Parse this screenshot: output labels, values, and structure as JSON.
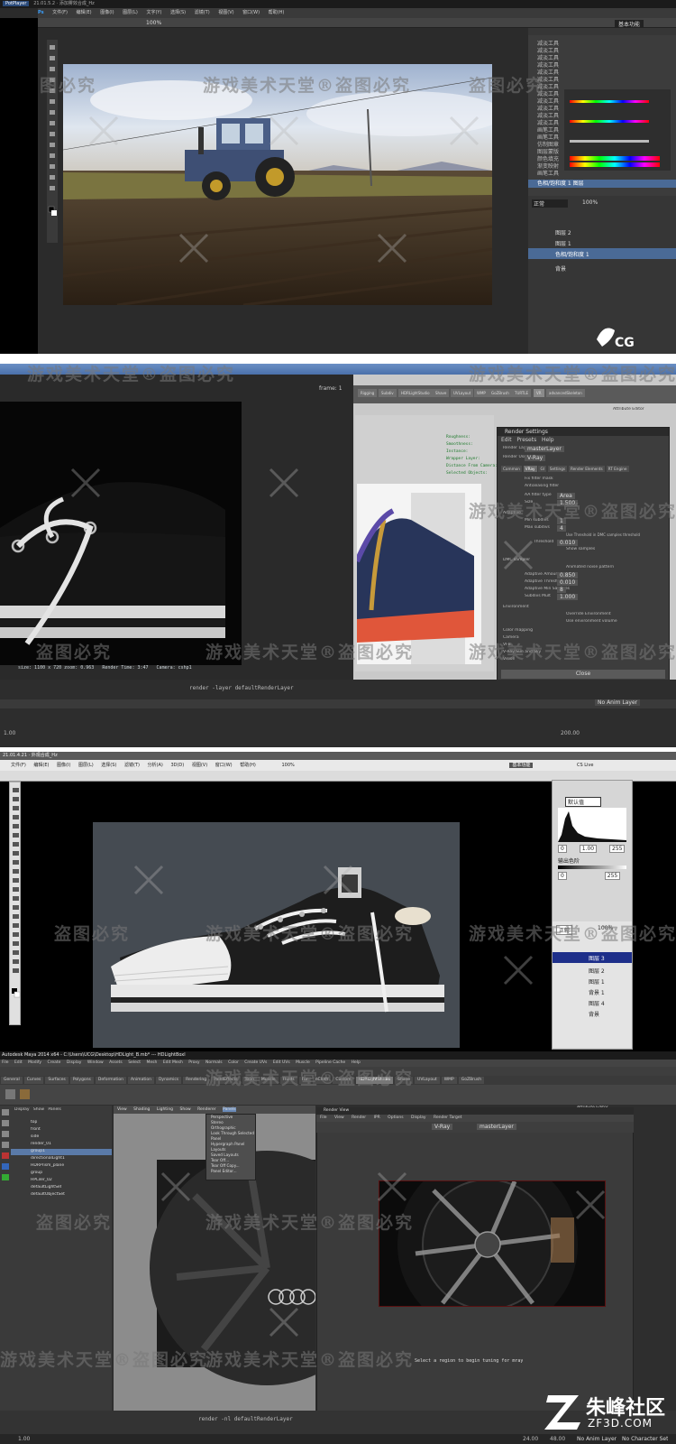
{
  "panel1": {
    "app_tab": "PotPlayer",
    "title": "21.01.5.2 · 添加雾效合成_Hz",
    "app_icon": "Ps",
    "menu": [
      "文件(F)",
      "编辑(E)",
      "图像(I)",
      "图层(L)",
      "文字(Y)",
      "选择(S)",
      "滤镜(T)",
      "视图(V)",
      "窗口(W)",
      "帮助(H)"
    ],
    "zoom": "100%",
    "workspace": "基本功能",
    "layers": [
      "减淡工具",
      "减淡工具",
      "减淡工具",
      "减淡工具",
      "减淡工具",
      "减淡工具",
      "减淡工具",
      "减淡工具",
      "减淡工具",
      "减淡工具",
      "减淡工具",
      "减淡工具",
      "画笔工具",
      "画笔工具",
      "仿制图章",
      "图层蒙版",
      "颜色填充",
      "渐变映射",
      "画笔工具"
    ],
    "active_layer": "色相/饱和度 1 图层",
    "layer_items": [
      "图层 2",
      "图层 1",
      "色相/饱和度 1",
      "背景"
    ],
    "blend_mode": "正常",
    "opacity": "100%",
    "logo": "CG"
  },
  "panel2": {
    "render_size": "size: 1100 x 720  zoom: 0.963",
    "render_time": "Render Time: 3:47",
    "camera": "Camera: cshp1",
    "frame_label": "frame: 1",
    "attr_lines": [
      "Roughness:",
      "Smoothness:",
      "Instance:",
      "Wrapper Layer:",
      "Distance From Camera:",
      "Selected Objects:"
    ],
    "shelf_tabs": [
      "Rigging",
      "Subdiv",
      "HDRLightStudio",
      "Shave",
      "UVLayout",
      "WMP",
      "GoZBrush",
      "TURTLE",
      "VR",
      "advancedSkeleton"
    ],
    "window_title": "Render Settings",
    "menu": [
      "Edit",
      "Presets",
      "Help"
    ],
    "render_layer_label": "Render Layer",
    "render_layer": "masterLayer",
    "render_using_label": "Render Using",
    "render_using": "V-Ray",
    "tabs": [
      "Common",
      "VRay",
      "GI",
      "Settings",
      "Render Elements",
      "RT Engine"
    ],
    "rows": [
      "Fix filter mask",
      "Antialiasing filter",
      "AA filter type",
      "Size",
      "Adaptive",
      "Min subdivs",
      "Max subdivs",
      "Use Threshold in DMC samples threshold",
      "Threshold",
      "Show samples",
      "DMC sampler",
      "Animated noise pattern",
      "Adaptive Amount",
      "Adaptive Threshold",
      "Adaptive Min Samples",
      "Subdivs Mult",
      "Environment",
      "Override Environment",
      "Use environment volume",
      "Color mapping",
      "Camera",
      "VFB",
      "V-Ray Sun and Sky",
      "Vision"
    ],
    "values": {
      "aa_type": "Area",
      "size": "1.500",
      "min": "1",
      "max": "4",
      "threshold": "0.010",
      "adapt_amount": "0.850",
      "adapt_thresh": "0.010",
      "adapt_min": "8",
      "subdiv_mult": "1.000"
    },
    "close_button": "Close",
    "attr_editor": "Attribute Editor",
    "timeline_start": "1.00",
    "timeline_end": "200.00",
    "anim_layer": "No Anim Layer",
    "command": "render -layer defaultRenderLayer"
  },
  "panel3": {
    "title": "21.01.4.21 · 外观合成_Hz",
    "menu": [
      "文件(F)",
      "编辑(E)",
      "图像(I)",
      "图层(L)",
      "选择(S)",
      "滤镜(T)",
      "分析(A)",
      "3D(D)",
      "视图(V)",
      "窗口(W)",
      "帮助(H)"
    ],
    "zoom": "100%",
    "workspace": "基本功能",
    "cs_live": "CS Live",
    "levels_preset": "默认值",
    "levels_values": [
      "0",
      "1.00",
      "255"
    ],
    "output_label": "输出色阶",
    "output_values": [
      "0",
      "255"
    ],
    "layers": [
      "图层 3",
      "图层 2",
      "图层 1",
      "背景 1",
      "图层 4",
      "背景"
    ],
    "blend": "正常",
    "opacity": "100%"
  },
  "panel4": {
    "title": "Autodesk Maya 2014 x64 - C:\\Users\\UCG\\Desktop\\HDLight_B.mb* --- HDLightBoxl",
    "menu": [
      "File",
      "Edit",
      "Modify",
      "Create",
      "Display",
      "Window",
      "Assets",
      "Select",
      "Mesh",
      "Edit Mesh",
      "Proxy",
      "Normals",
      "Color",
      "Create UVs",
      "Edit UVs",
      "Muscle",
      "Pipeline Cache",
      "Help"
    ],
    "shelf_tabs": [
      "General",
      "Curves",
      "Surfaces",
      "Polygons",
      "Deformation",
      "Animation",
      "Dynamics",
      "Rendering",
      "PaintEffects",
      "Toon",
      "Muscle",
      "Fluids",
      "Fur",
      "nCloth",
      "Custom",
      "HDRLightStudio",
      "Shave",
      "UVLayout",
      "WMP",
      "GoZBrush"
    ],
    "outliner_menu": [
      "Display",
      "Show",
      "Panels"
    ],
    "outliner_items": [
      "top",
      "front",
      "side",
      "render_01",
      "group1",
      "directionalLight1",
      "HDRPrism_plane",
      "group",
      "HPLiler_02",
      "defaultLightSet",
      "defaultObjectSet"
    ],
    "viewport_menu": [
      "View",
      "Shading",
      "Lighting",
      "Show",
      "Renderer",
      "Panels"
    ],
    "dropdown": [
      "Perspective",
      "Stereo",
      "Orthographic",
      "Look Through Selected",
      "Panel",
      "Hypergraph Panel",
      "Layouts",
      "Saved Layouts",
      "Tear Off...",
      "Tear Off Copy...",
      "Panel Editor..."
    ],
    "render_title": "Render View",
    "render_menu": [
      "File",
      "View",
      "Render",
      "IPR",
      "Options",
      "Display",
      "Render Target"
    ],
    "render_layer": "masterLayer",
    "render_cam": "V-Ray",
    "caption": "Select a region to begin tuning for mray",
    "attr_editor": "Attribute Editor",
    "command": "render -nl defaultRenderLayer",
    "time_start": "1.00",
    "time_end": "24.00",
    "time_end2": "48.00",
    "anim_layer": "No Anim Layer",
    "character_set": "No Character Set"
  },
  "watermarks": {
    "main": "游戏美术天堂®盗图必究",
    "short": "盗图必究",
    "left_small": "图必究"
  },
  "footer": {
    "brand": "朱峰社区",
    "url": "ZF3D.COM"
  }
}
